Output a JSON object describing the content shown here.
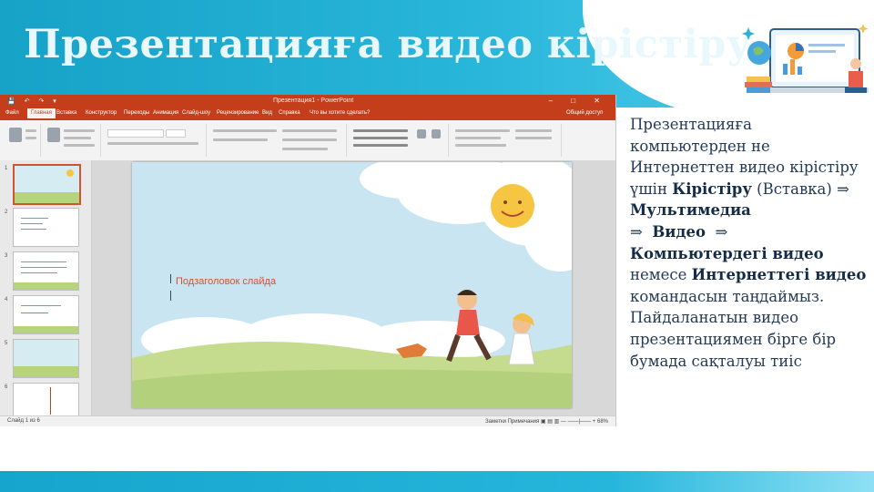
{
  "title": "Презентацияға видео кірістіру",
  "screenshot": {
    "window_title": "Презентация1 - PowerPoint",
    "quick_access": "💾 ↶ ↷ ▾",
    "window_buttons": "– □ ✕",
    "tabs": [
      "Файл",
      "Главная",
      "Вставка",
      "Конструктор",
      "Переходы",
      "Анимация",
      "Слайд-шоу",
      "Рецензирование",
      "Вид",
      "Справка",
      "Что вы хотите сделать?"
    ],
    "active_tab_index": 1,
    "share_label": "Общий доступ",
    "slide_numbers": [
      "1",
      "2",
      "3",
      "4",
      "5",
      "6"
    ],
    "subtitle_placeholder": "Подзаголовок слайда",
    "status_left": "Слайд 1 из 6",
    "status_right": "Заметки   Примечания   ▣ ▤ ▥   — ——|—— +  68%"
  },
  "description": {
    "t1": "Презентацияға компьютерден не Интернеттен видео кірістіру үшін",
    "b1": "Кірістіру",
    "t2": "(Вставка)",
    "arrow": "⇒",
    "b2": "Мультимедиа",
    "b3": "Видео",
    "b4": "Компьютердегі видео",
    "t3": "немесе",
    "b5": "Интернеттегі видео",
    "t4": "командасын таңдаймыз. Пайдаланатын видео презентациямен бірге бір бумада сақталуы тиіс"
  },
  "colors": {
    "accent": "#1aa5cc",
    "powerpoint": "#c43e1c",
    "text": "#243a56"
  }
}
